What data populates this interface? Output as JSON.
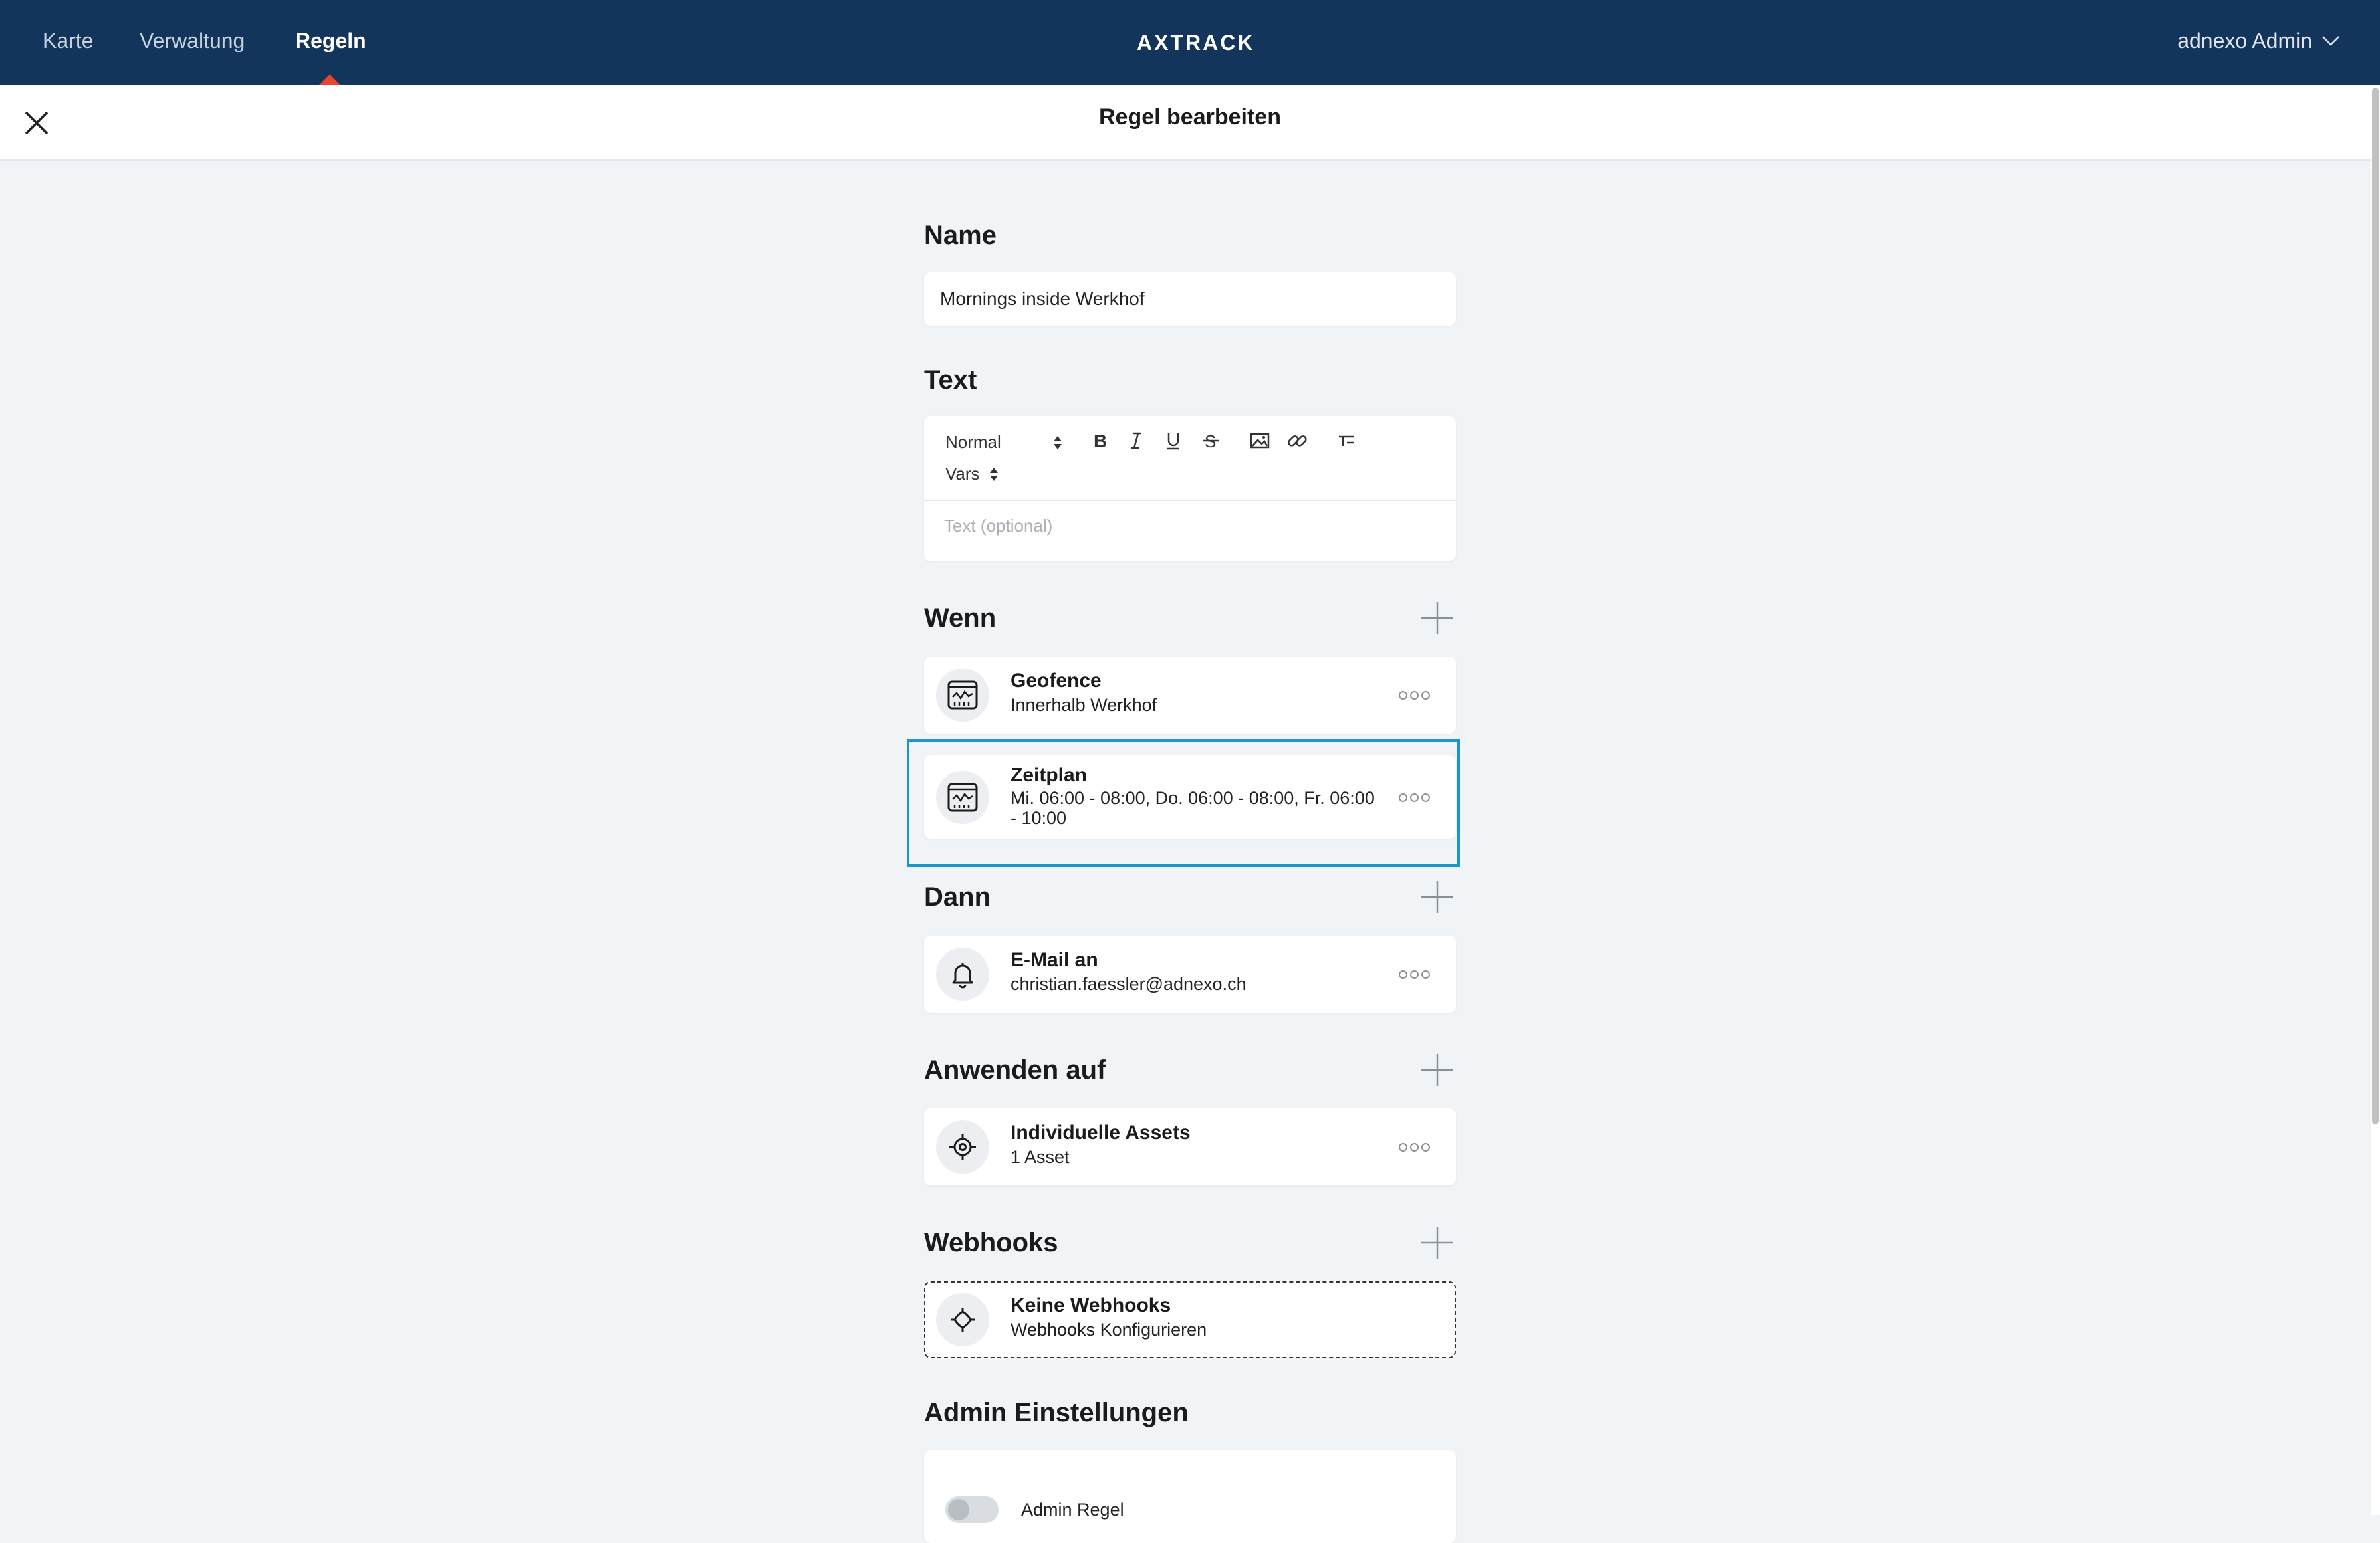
{
  "nav": {
    "items": [
      "Karte",
      "Verwaltung",
      "Regeln"
    ],
    "active_index": 2,
    "logo": "AXTRACK",
    "user": "adnexo Admin"
  },
  "header": {
    "title": "Regel bearbeiten"
  },
  "form": {
    "name": {
      "label": "Name",
      "value": "Mornings inside Werkhof"
    },
    "text": {
      "label": "Text",
      "format_select": "Normal",
      "vars_select": "Vars",
      "placeholder": "Text (optional)"
    },
    "wenn": {
      "label": "Wenn",
      "cards": [
        {
          "title": "Geofence",
          "subtitle": "Innerhalb Werkhof",
          "icon": "chart-panel-icon"
        },
        {
          "title": "Zeitplan",
          "subtitle": "Mi. 06:00 - 08:00, Do. 06:00 - 08:00, Fr. 06:00 - 10:00",
          "icon": "chart-panel-icon",
          "selected": true
        }
      ]
    },
    "dann": {
      "label": "Dann",
      "cards": [
        {
          "title": "E-Mail an",
          "subtitle": "christian.faessler@adnexo.ch",
          "icon": "bell-icon"
        }
      ]
    },
    "anwenden": {
      "label": "Anwenden auf",
      "cards": [
        {
          "title": "Individuelle Assets",
          "subtitle": "1 Asset",
          "icon": "target-icon"
        }
      ]
    },
    "webhooks": {
      "label": "Webhooks",
      "empty_title": "Keine Webhooks",
      "empty_subtitle": "Webhooks Konfigurieren",
      "icon": "plug-icon"
    },
    "admin": {
      "label": "Admin Einstellungen",
      "toggle_label": "Admin Regel",
      "toggle_on": false
    }
  },
  "colors": {
    "nav_bg": "#13355c",
    "accent": "#e8442e",
    "selection": "#1b95d0",
    "page_bg": "#f1f4f7"
  }
}
